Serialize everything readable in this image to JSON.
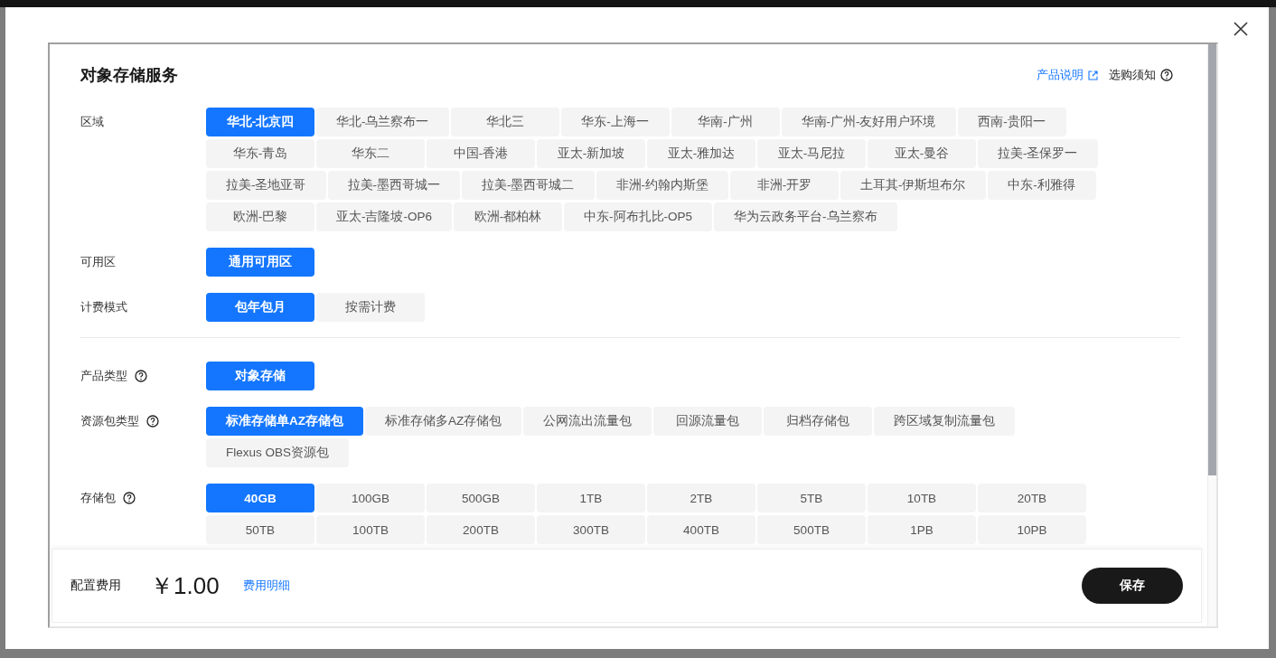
{
  "dialog": {
    "title": "对象存储服务",
    "links": [
      {
        "label": "产品说明",
        "kind": "external"
      },
      {
        "label": "选购须知",
        "kind": "help"
      }
    ]
  },
  "groups": [
    [
      {
        "label": "区域",
        "help": false,
        "options": [
          {
            "label": "华北-北京四",
            "selected": true
          },
          {
            "label": "华北-乌兰察布一",
            "selected": false
          },
          {
            "label": "华北三",
            "selected": false
          },
          {
            "label": "华东-上海一",
            "selected": false
          },
          {
            "label": "华南-广州",
            "selected": false
          },
          {
            "label": "华南-广州-友好用户环境",
            "selected": false
          },
          {
            "label": "西南-贵阳一",
            "selected": false
          },
          {
            "label": "华东-青岛",
            "selected": false
          },
          {
            "label": "华东二",
            "selected": false
          },
          {
            "label": "中国-香港",
            "selected": false
          },
          {
            "label": "亚太-新加坡",
            "selected": false
          },
          {
            "label": "亚太-雅加达",
            "selected": false
          },
          {
            "label": "亚太-马尼拉",
            "selected": false
          },
          {
            "label": "亚太-曼谷",
            "selected": false
          },
          {
            "label": "拉美-圣保罗一",
            "selected": false
          },
          {
            "label": "拉美-圣地亚哥",
            "selected": false
          },
          {
            "label": "拉美-墨西哥城一",
            "selected": false
          },
          {
            "label": "拉美-墨西哥城二",
            "selected": false
          },
          {
            "label": "非洲-约翰内斯堡",
            "selected": false
          },
          {
            "label": "非洲-开罗",
            "selected": false
          },
          {
            "label": "土耳其-伊斯坦布尔",
            "selected": false
          },
          {
            "label": "中东-利雅得",
            "selected": false
          },
          {
            "label": "欧洲-巴黎",
            "selected": false
          },
          {
            "label": "亚太-吉隆坡-OP6",
            "selected": false
          },
          {
            "label": "欧洲-都柏林",
            "selected": false
          },
          {
            "label": "中东-阿布扎比-OP5",
            "selected": false
          },
          {
            "label": "华为云政务平台-乌兰察布",
            "selected": false
          }
        ]
      },
      {
        "label": "可用区",
        "help": false,
        "options": [
          {
            "label": "通用可用区",
            "selected": true
          }
        ]
      },
      {
        "label": "计费模式",
        "help": false,
        "options": [
          {
            "label": "包年包月",
            "selected": true
          },
          {
            "label": "按需计费",
            "selected": false
          }
        ]
      }
    ],
    [
      {
        "label": "产品类型",
        "help": true,
        "options": [
          {
            "label": "对象存储",
            "selected": true
          }
        ]
      },
      {
        "label": "资源包类型",
        "help": true,
        "options": [
          {
            "label": "标准存储单AZ存储包",
            "selected": true
          },
          {
            "label": "标准存储多AZ存储包",
            "selected": false
          },
          {
            "label": "公网流出流量包",
            "selected": false
          },
          {
            "label": "回源流量包",
            "selected": false
          },
          {
            "label": "归档存储包",
            "selected": false
          },
          {
            "label": "跨区域复制流量包",
            "selected": false
          },
          {
            "label": "Flexus OBS资源包",
            "selected": false
          }
        ]
      },
      {
        "label": "存储包",
        "help": true,
        "fixed": true,
        "options": [
          {
            "label": "40GB",
            "selected": true
          },
          {
            "label": "100GB",
            "selected": false
          },
          {
            "label": "500GB",
            "selected": false
          },
          {
            "label": "1TB",
            "selected": false
          },
          {
            "label": "2TB",
            "selected": false
          },
          {
            "label": "5TB",
            "selected": false
          },
          {
            "label": "10TB",
            "selected": false
          },
          {
            "label": "20TB",
            "selected": false
          },
          {
            "label": "50TB",
            "selected": false
          },
          {
            "label": "100TB",
            "selected": false
          },
          {
            "label": "200TB",
            "selected": false
          },
          {
            "label": "300TB",
            "selected": false
          },
          {
            "label": "400TB",
            "selected": false
          },
          {
            "label": "500TB",
            "selected": false
          },
          {
            "label": "1PB",
            "selected": false
          },
          {
            "label": "10PB",
            "selected": false
          }
        ]
      }
    ]
  ],
  "footer": {
    "cost_label": "配置费用",
    "price": "￥1.00",
    "detail_link": "费用明细",
    "save_button": "保存"
  }
}
